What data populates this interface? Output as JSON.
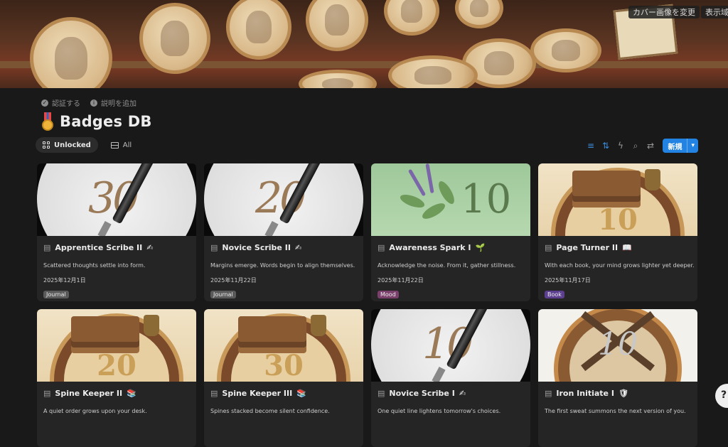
{
  "cover": {
    "change_cover": "カバー画像を変更",
    "show_full": "表示域の変"
  },
  "meta": {
    "verify": "認証する",
    "add_description": "説明を追加"
  },
  "page": {
    "title": "Badges DB",
    "icon": "medal-icon"
  },
  "views": [
    {
      "label": "Unlocked",
      "icon": "gallery-icon",
      "active": true
    },
    {
      "label": "All",
      "icon": "table-icon",
      "active": false
    }
  ],
  "toolbar": {
    "tools": [
      "filter-icon",
      "sort-icon",
      "lightning-icon",
      "search-icon",
      "settings-icon"
    ],
    "new_label": "新規"
  },
  "tag_colors": {
    "Journal": "#5a5a5a",
    "Mood": "#7a3f6b",
    "Book": "#5d3f8f"
  },
  "cards": [
    {
      "name": "Apprentice Scribe II",
      "emoji": "✍",
      "desc": "Scattered thoughts settle into form.",
      "date": "2025年12月1日",
      "tag": "Journal",
      "art": "pen",
      "number": "30"
    },
    {
      "name": "Novice Scribe II",
      "emoji": "✍",
      "desc": "Margins emerge. Words begin to align themselves.",
      "date": "2025年11月22日",
      "tag": "Journal",
      "art": "pen",
      "number": "20"
    },
    {
      "name": "Awareness Spark I",
      "emoji": "🌱",
      "desc": "Acknowledge the noise. From it, gather stillness.",
      "date": "2025年11月22日",
      "tag": "Mood",
      "art": "sage",
      "number": "10"
    },
    {
      "name": "Page Turner II",
      "emoji": "📖",
      "desc": "With each book, your mind grows lighter yet deeper.",
      "date": "2025年11月17日",
      "tag": "Book",
      "art": "book",
      "number": "10"
    },
    {
      "name": "Spine Keeper II",
      "emoji": "📚",
      "desc": "A quiet order grows upon your desk.",
      "date": "",
      "tag": "",
      "art": "book",
      "number": "20"
    },
    {
      "name": "Spine Keeper III",
      "emoji": "📚",
      "desc": "Spines stacked become silent confidence.",
      "date": "",
      "tag": "",
      "art": "book",
      "number": "30"
    },
    {
      "name": "Novice Scribe I",
      "emoji": "✍",
      "desc": "One quiet line lightens tomorrow's choices.",
      "date": "",
      "tag": "",
      "art": "pen",
      "number": "10"
    },
    {
      "name": "Iron Initiate I",
      "emoji": "🛡",
      "desc": "The first sweat summons the next version of you.",
      "date": "",
      "tag": "",
      "art": "dumbbell",
      "number": "10"
    }
  ],
  "help": {
    "label": "?"
  }
}
